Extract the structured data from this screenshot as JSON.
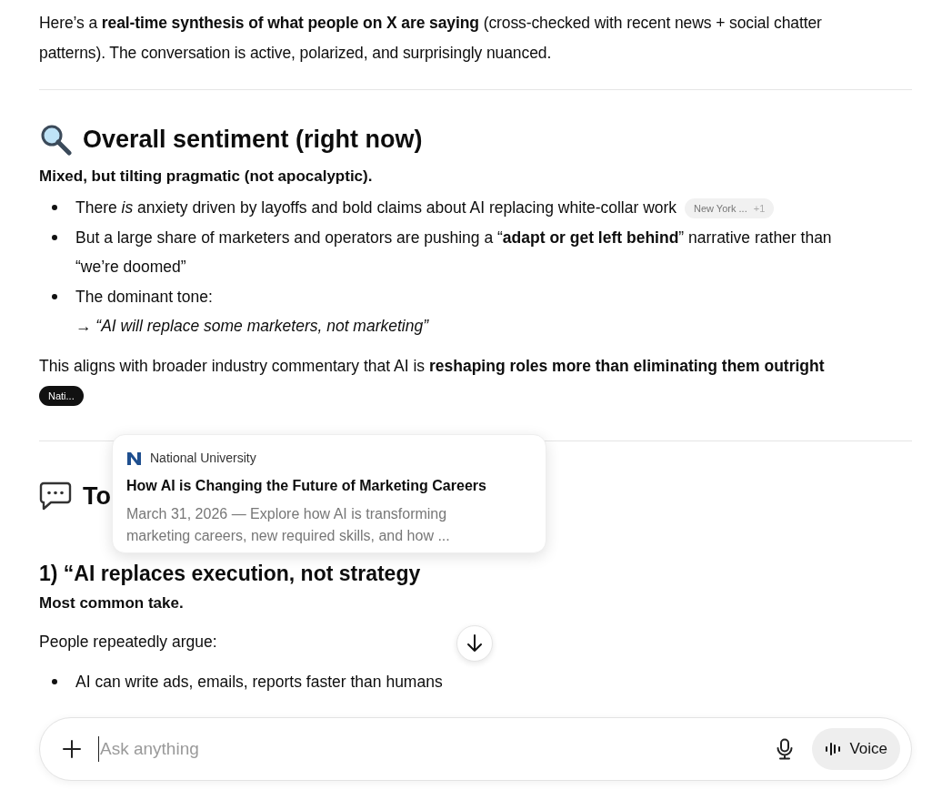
{
  "intro": "Here’s a **real-time synthesis of what people on X are saying** (cross-checked with recent news + social chatter patterns). The conversation is active, polarized, and surprisingly nuanced.",
  "section_1": {
    "heading": "Overall sentiment (right now)",
    "lead": "Mixed, but tilting pragmatic (not apocalyptic).",
    "bullets": [
      {
        "text": "There *is* anxiety driven by layoffs and bold claims about AI replacing white-collar work",
        "chip": {
          "label": "New York ...",
          "extra": "+1",
          "selected": false
        }
      },
      {
        "text": "But a large share of marketers and operators are pushing a “**adapt or get left behind**” narrative rather than “we’re doomed”"
      },
      {
        "text": "The dominant tone:",
        "quote": "→ “AI will replace some marketers, not marketing”"
      }
    ],
    "closing": "This aligns with broader industry commentary that AI is **reshaping roles more than eliminating them outright**",
    "closing_chip": {
      "label": "Nati...",
      "selected": true
    }
  },
  "section_2": {
    "heading": "To",
    "subheading": "1) “AI replaces execution, not strategy",
    "lead": "Most common take.",
    "text": "People repeatedly argue:",
    "bullets": [
      "AI can write ads, emails, reports faster than humans"
    ]
  },
  "popover": {
    "source": "National University",
    "title": "How AI is Changing the Future of Marketing Careers",
    "snippet": "March 31, 2026 — Explore how AI is transforming marketing careers, new required skills, and how ..."
  },
  "composer": {
    "placeholder": "Ask anything",
    "voice_label": "Voice"
  }
}
